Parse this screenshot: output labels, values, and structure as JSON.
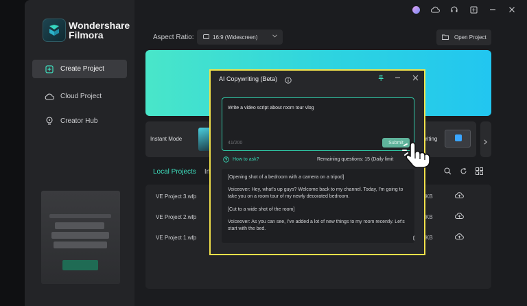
{
  "brand": {
    "line1": "Wondershare",
    "line2": "Filmora"
  },
  "sidebar": {
    "items": [
      {
        "label": "Create Project",
        "icon": "plus-square-icon",
        "active": true
      },
      {
        "label": "Cloud Project",
        "icon": "cloud-icon",
        "active": false
      },
      {
        "label": "Creator Hub",
        "icon": "lightbulb-icon",
        "active": false
      }
    ]
  },
  "toolbar": {
    "aspect_label": "Aspect Ratio:",
    "aspect_value": "16:9 (Widescreen)",
    "open_project": "Open Project"
  },
  "modes": {
    "instant_mode": "Instant Mode",
    "partial_label": "riting"
  },
  "tabs": {
    "local": "Local Projects",
    "partial": "Ins"
  },
  "projects": [
    {
      "name": "VE Project 3.wfp",
      "size": "KB"
    },
    {
      "name": "VE Project 2.wfp",
      "size": "KB"
    },
    {
      "name": "VE Project 1.wfp",
      "size": "KB"
    }
  ],
  "modal": {
    "title": "AI Copywriting (Beta)",
    "prompt": "Write a video script about room tour vlog",
    "counter": "41/200",
    "submit": "Submit",
    "howto": "How to ask?",
    "remaining": "Remaining questions: 15 (Daily limit",
    "result": [
      "[Opening shot of a bedroom with a camera on a tripod]",
      "Voiceover: Hey, what's up guys? Welcome back to my channel. Today, I'm going to take you on a room tour of my newly decorated bedroom.",
      "[Cut to a wide shot of the room]",
      "Voiceover: As you can see, I've added a lot of new things to my room recently. Let's start with the bed."
    ]
  },
  "colors": {
    "accent": "#2fc8a6",
    "highlight_border": "#f2e14a",
    "banner_start": "#49e6c9",
    "banner_end": "#22c6f0"
  }
}
